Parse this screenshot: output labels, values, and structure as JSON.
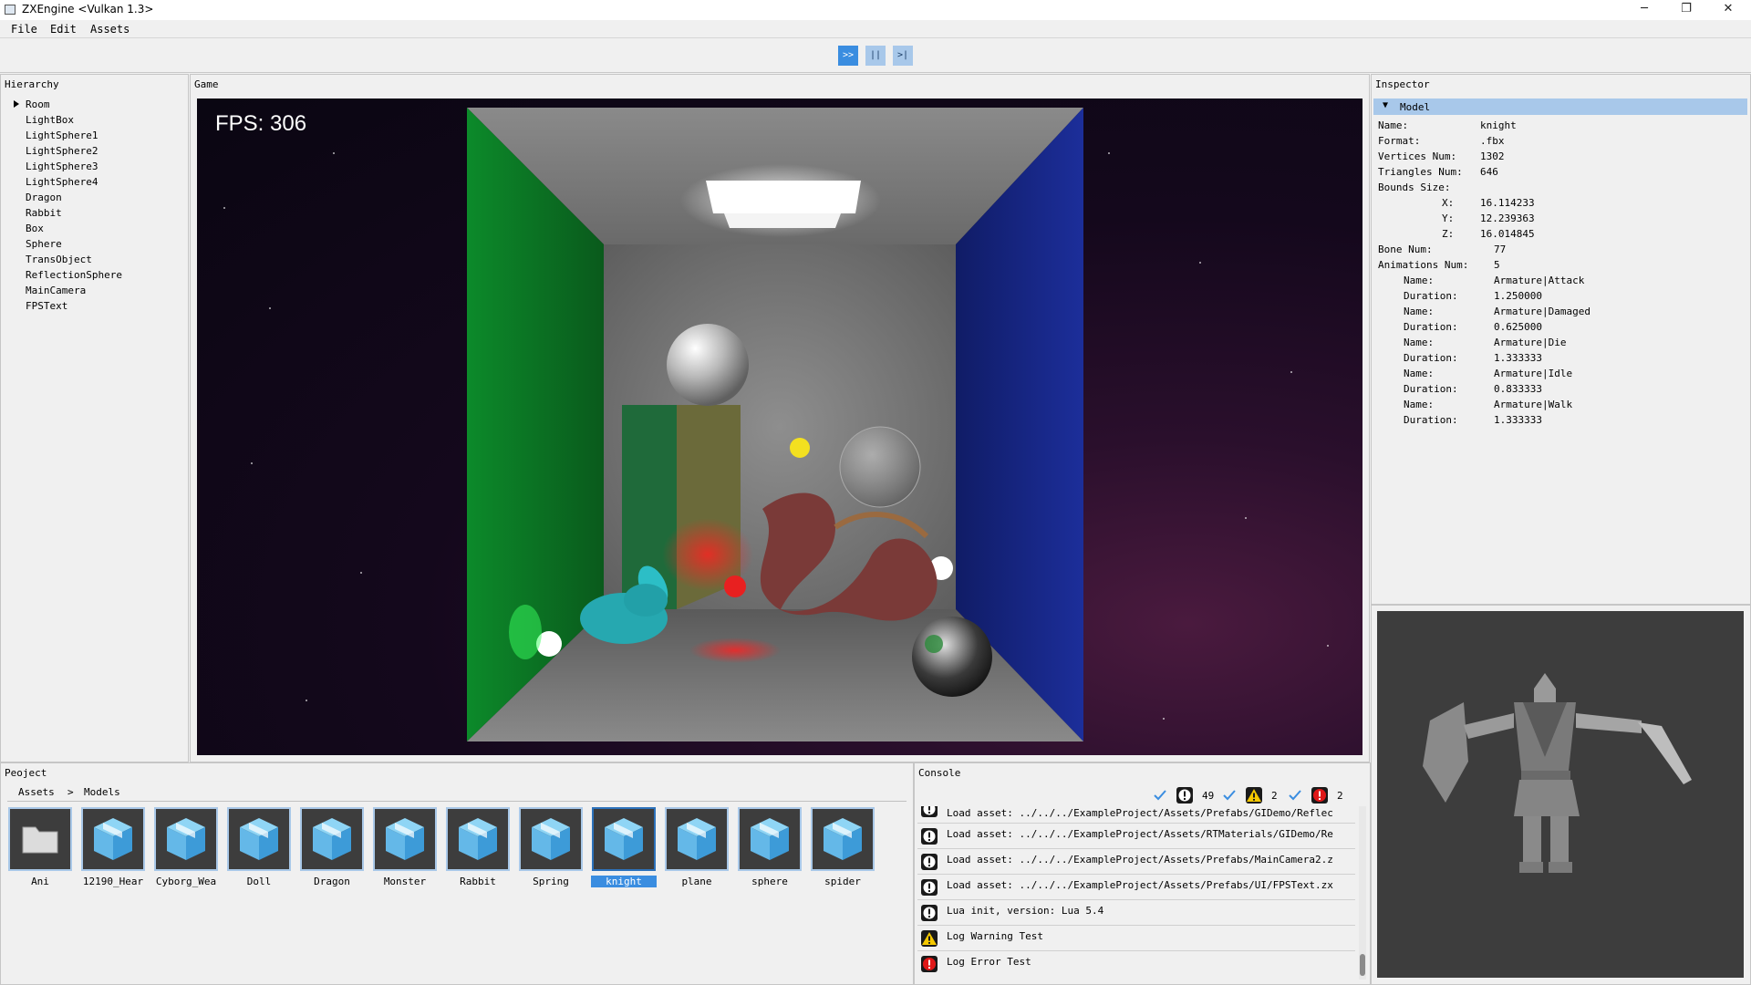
{
  "window": {
    "title": "ZXEngine <Vulkan 1.3>",
    "minimize": "─",
    "maximize": "❐",
    "close": "✕"
  },
  "menu": [
    "File",
    "Edit",
    "Assets"
  ],
  "toolbar": {
    "play": ">>",
    "pause": "||",
    "step": ">|"
  },
  "hierarchy": {
    "title": "Hierarchy",
    "items": [
      "Room",
      "LightBox",
      "LightSphere1",
      "LightSphere2",
      "LightSphere3",
      "LightSphere4",
      "Dragon",
      "Rabbit",
      "Box",
      "Sphere",
      "TransObject",
      "ReflectionSphere",
      "MainCamera",
      "FPSText"
    ]
  },
  "game": {
    "title": "Game",
    "fps": "FPS: 306"
  },
  "inspector": {
    "title": "Inspector",
    "section": "Model",
    "name_label": "Name:",
    "name": "knight",
    "format_label": "Format:",
    "format": ".fbx",
    "vertices_label": "Vertices Num:",
    "vertices": "1302",
    "triangles_label": "Triangles Num:",
    "triangles": "646",
    "bounds_label": "Bounds Size:",
    "bx_label": "X:",
    "bx": "16.114233",
    "by_label": "Y:",
    "by": "12.239363",
    "bz_label": "Z:",
    "bz": "16.014845",
    "bone_label": "Bone Num:",
    "bone": "77",
    "anim_label": "Animations Num:",
    "anim": "5",
    "anim_name_label": "Name:",
    "anim_duration_label": "Duration:",
    "animations": [
      {
        "name": "Armature|Attack",
        "duration": "1.250000"
      },
      {
        "name": "Armature|Damaged",
        "duration": "0.625000"
      },
      {
        "name": "Armature|Die",
        "duration": "1.333333"
      },
      {
        "name": "Armature|Idle",
        "duration": "0.833333"
      },
      {
        "name": "Armature|Walk",
        "duration": "1.333333"
      }
    ]
  },
  "project": {
    "title": "Peoject",
    "breadcrumb": [
      "Assets",
      ">",
      "Models"
    ],
    "assets": [
      {
        "label": "Ani",
        "icon": "folder-icon"
      },
      {
        "label": "12190_Hear",
        "icon": "model-cube-icon"
      },
      {
        "label": "Cyborg_Wea",
        "icon": "model-cube-icon"
      },
      {
        "label": "Doll",
        "icon": "model-cube-icon"
      },
      {
        "label": "Dragon",
        "icon": "model-cube-icon"
      },
      {
        "label": "Monster",
        "icon": "model-cube-icon"
      },
      {
        "label": "Rabbit",
        "icon": "model-cube-icon"
      },
      {
        "label": "Spring",
        "icon": "model-cube-icon"
      },
      {
        "label": "knight",
        "icon": "model-cube-icon",
        "selected": true
      },
      {
        "label": "plane",
        "icon": "model-cube-icon"
      },
      {
        "label": "sphere",
        "icon": "model-cube-icon"
      },
      {
        "label": "spider",
        "icon": "model-cube-icon"
      }
    ]
  },
  "console": {
    "title": "Console",
    "info_count": "49",
    "warning_count": "2",
    "error_count": "2",
    "logs": [
      {
        "type": "info",
        "text": "Load asset: ../../../ExampleProject/Assets/Prefabs/GIDemo/Reflec"
      },
      {
        "type": "info",
        "text": "Load asset: ../../../ExampleProject/Assets/RTMaterials/GIDemo/Re"
      },
      {
        "type": "info",
        "text": "Load asset: ../../../ExampleProject/Assets/Prefabs/MainCamera2.z"
      },
      {
        "type": "info",
        "text": "Load asset: ../../../ExampleProject/Assets/Prefabs/UI/FPSText.zx"
      },
      {
        "type": "info",
        "text": "Lua init, version: Lua 5.4"
      },
      {
        "type": "warning",
        "text": "Log Warning Test"
      },
      {
        "type": "error",
        "text": "Log Error Test"
      }
    ]
  },
  "colors": {
    "accent": "#3a8de0",
    "selection_light": "#a8c8ea",
    "panel_bg": "#f0f0f0",
    "warning": "#f5c800",
    "error": "#e01818"
  }
}
